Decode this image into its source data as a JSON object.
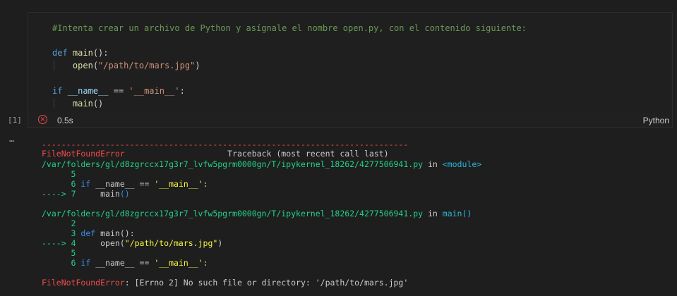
{
  "cell": {
    "execution_count": "[1]",
    "code_lines": [
      "#Intenta crear un archivo de Python y asígnale el nombre open.py, con el contenido siguiente:",
      "",
      "def main():",
      "    open(\"/path/to/mars.jpg\")",
      "",
      "if __name__ == '__main__':",
      "    main()"
    ],
    "status": {
      "icon": "error-circle-x-icon",
      "duration": "0.5s",
      "language": "Python"
    }
  },
  "output": {
    "ellipsis": "…",
    "dashes": "---------------------------------------------------------------------------",
    "error_name": "FileNotFoundError",
    "traceback_header": "Traceback (most recent call last)",
    "frame1": {
      "path": "/var/folders/gl/d8zgrccx17g3r7_lvfw5pgrm0000gn/T/ipykernel_18262/4277506941.py",
      "in_word": "in",
      "scope": "<module>",
      "lines": [
        {
          "arrow": "",
          "num": "5",
          "code": ""
        },
        {
          "arrow": "",
          "num": "6",
          "code": "if __name__ == '__main__':"
        },
        {
          "arrow": "---->",
          "num": "7",
          "code": "    main()"
        }
      ]
    },
    "frame2": {
      "path": "/var/folders/gl/d8zgrccx17g3r7_lvfw5pgrm0000gn/T/ipykernel_18262/4277506941.py",
      "in_word": "in",
      "scope": "main()",
      "lines": [
        {
          "arrow": "",
          "num": "2",
          "code": ""
        },
        {
          "arrow": "",
          "num": "3",
          "code": "def main():"
        },
        {
          "arrow": "---->",
          "num": "4",
          "code": "    open(\"/path/to/mars.jpg\")"
        },
        {
          "arrow": "",
          "num": "5",
          "code": ""
        },
        {
          "arrow": "",
          "num": "6",
          "code": "if __name__ == '__main__':"
        }
      ]
    },
    "final_error_name": "FileNotFoundError",
    "final_error_message": ": [Errno 2] No such file or directory: '/path/to/mars.jpg'"
  }
}
